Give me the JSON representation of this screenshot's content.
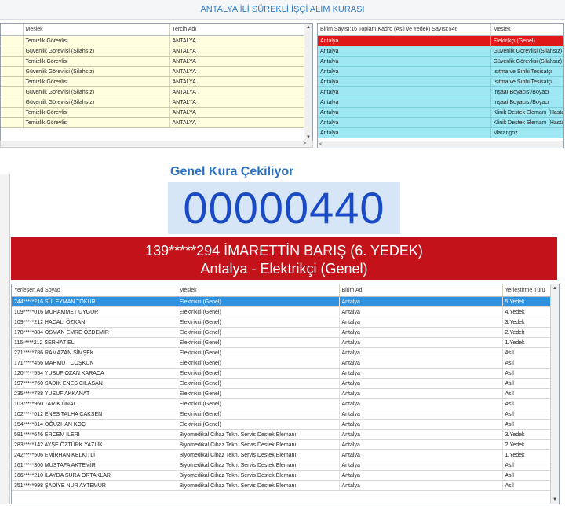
{
  "title": "ANTALYA İLİ SÜREKLİ İŞÇİ ALIM KURASI",
  "left_table": {
    "headers": [
      "Meslek",
      "Tercih Adı"
    ],
    "rows": [
      [
        "Temizlik Görevlisi",
        "ANTALYA"
      ],
      [
        "Güvenlik Görevlisi (Silahsız)",
        "ANTALYA"
      ],
      [
        "Temizlik Görevlisi",
        "ANTALYA"
      ],
      [
        "Güvenlik Görevlisi (Silahsız)",
        "ANTALYA"
      ],
      [
        "Temizlik Görevlisi",
        "ANTALYA"
      ],
      [
        "Güvenlik Görevlisi (Silahsız)",
        "ANTALYA"
      ],
      [
        "Güvenlik Görevlisi (Silahsız)",
        "ANTALYA"
      ],
      [
        "Temizlik Görevlisi",
        "ANTALYA"
      ],
      [
        "Temizlik Görevlisi",
        "ANTALYA"
      ]
    ]
  },
  "right_table": {
    "headers": [
      "Birim Sayısı:16 Toplam Kadro (Asil ve Yedek) Sayısı:546",
      "Meslek"
    ],
    "rows": [
      [
        "Antalya",
        "Elektrikçi (Genel)"
      ],
      [
        "Antalya",
        "Güvenlik Görevlisi (Silahsız)"
      ],
      [
        "Antalya",
        "Güvenlik Görevlisi (Silahsız)"
      ],
      [
        "Antalya",
        "Isıtma ve Sıhhi Tesisatçı"
      ],
      [
        "Antalya",
        "Isıtma ve Sıhhi Tesisatçı"
      ],
      [
        "Antalya",
        "İnşaat Boyacısı/Boyacı"
      ],
      [
        "Antalya",
        "İnşaat Boyacısı/Boyacı"
      ],
      [
        "Antalya",
        "Klinik Destek Elemanı (Hastane)"
      ],
      [
        "Antalya",
        "Klinik Destek Elemanı (Hastane)"
      ],
      [
        "Antalya",
        "Marangoz"
      ]
    ]
  },
  "banner": {
    "title": "Genel Kura Çekiliyor",
    "counter": "00000440",
    "winner_line1": "139*****294 İMARETTİN BARIŞ (6. YEDEK)",
    "winner_line2": "Antalya - Elektrikçi (Genel)"
  },
  "bottom_table": {
    "headers": [
      "Yerleşen Ad Soyad",
      "Meslek",
      "Birim Ad",
      "Yerleştirme Türü"
    ],
    "rows": [
      [
        "244*****216 SÜLEYMAN TOKUR",
        "Elektrikçi (Genel)",
        "Antalya",
        "5.Yedek"
      ],
      [
        "109*****016 MUHAMMET UYGUR",
        "Elektrikçi (Genel)",
        "Antalya",
        "4.Yedek"
      ],
      [
        "109*****212 HACALI ÖZKAN",
        "Elektrikçi (Genel)",
        "Antalya",
        "3.Yedek"
      ],
      [
        "178*****884 OSMAN EMRE ÖZDEMİR",
        "Elektrikçi (Genel)",
        "Antalya",
        "2.Yedek"
      ],
      [
        "116*****212 SERHAT EL",
        "Elektrikçi (Genel)",
        "Antalya",
        "1.Yedek"
      ],
      [
        "271*****786 RAMAZAN ŞİMŞEK",
        "Elektrikçi (Genel)",
        "Antalya",
        "Asil"
      ],
      [
        "171*****456 MAHMUT COŞKUN",
        "Elektrikçi (Genel)",
        "Antalya",
        "Asil"
      ],
      [
        "120*****554 YUSUF OZAN KARACA",
        "Elektrikçi (Genel)",
        "Antalya",
        "Asil"
      ],
      [
        "197*****760 SADIK ENES CILASAN",
        "Elektrikçi (Genel)",
        "Antalya",
        "Asil"
      ],
      [
        "235*****788 YUSUF AKKANAT",
        "Elektrikçi (Genel)",
        "Antalya",
        "Asil"
      ],
      [
        "103*****960 TARIK ÜNAL",
        "Elektrikçi (Genel)",
        "Antalya",
        "Asil"
      ],
      [
        "102*****012 ENES TALHA ÇAKSEN",
        "Elektrikçi (Genel)",
        "Antalya",
        "Asil"
      ],
      [
        "154*****314 OĞUZHAN KOÇ",
        "Elektrikçi (Genel)",
        "Antalya",
        "Asil"
      ],
      [
        "581*****646 ERCEM İLERİ",
        "Biyomedikal Cihaz Tekn. Servis Destek Elemanı",
        "Antalya",
        "3.Yedek"
      ],
      [
        "283*****142 AYŞE ÖZTÜRK YAZLIK",
        "Biyomedikal Cihaz Tekn. Servis Destek Elemanı",
        "Antalya",
        "2.Yedek"
      ],
      [
        "242*****506 EMİRHAN KELKİTLİ",
        "Biyomedikal Cihaz Tekn. Servis Destek Elemanı",
        "Antalya",
        "1.Yedek"
      ],
      [
        "161*****300 MUSTAFA AKTEMİR",
        "Biyomedikal Cihaz Tekn. Servis Destek Elemanı",
        "Antalya",
        "Asil"
      ],
      [
        "166*****210 İLAYDA ŞURA ORTAKLAR",
        "Biyomedikal Cihaz Tekn. Servis Destek Elemanı",
        "Antalya",
        "Asil"
      ],
      [
        "351*****998 ŞADİYE NUR AYTEMUR",
        "Biyomedikal Cihaz Tekn. Servis Destek Elemanı",
        "Antalya",
        "Asil"
      ]
    ]
  },
  "colors": {
    "title_text": "#2f7fc8",
    "left_row_bg": "#ffffe0",
    "right_row_bg": "#9ee8f4",
    "selected_red": "#e01818",
    "counter_text": "#1a4bc4",
    "winner_bg": "#c4121a",
    "selected_blue": "#2f92e0"
  },
  "icons": {
    "scroll_up": "▲",
    "scroll_down": "▼",
    "scroll_left": "<",
    "scroll_right": ">"
  }
}
